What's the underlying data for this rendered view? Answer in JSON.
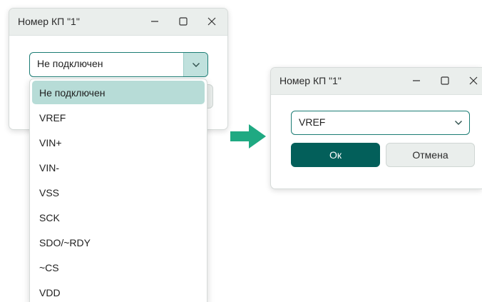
{
  "left_window": {
    "title": "Номер КП \"1\"",
    "combo_value": "Не подключен",
    "dropdown_items": [
      "Не подключен",
      "VREF",
      "VIN+",
      "VIN-",
      "VSS",
      "SCK",
      "SDO/~RDY",
      "~CS",
      "VDD"
    ],
    "selected_index": 0
  },
  "right_window": {
    "title": "Номер КП \"1\"",
    "combo_value": "VREF",
    "ok_label": "Ок",
    "cancel_label": "Отмена"
  },
  "colors": {
    "accent": "#035f5a",
    "accent_light": "#b7dcd7",
    "arrow": "#1fa982",
    "titlebar": "#eaeeec"
  },
  "icons": {
    "minimize": "minimize-icon",
    "maximize": "maximize-icon",
    "close": "close-icon",
    "dropdown": "chevron-down-icon",
    "transition": "arrow-right-icon"
  }
}
